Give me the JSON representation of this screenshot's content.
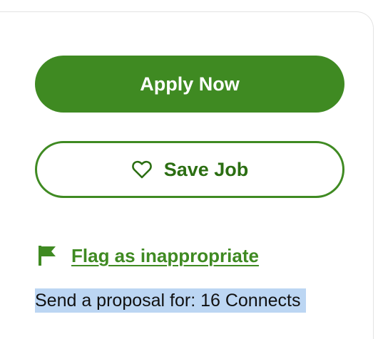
{
  "actions": {
    "apply_label": "Apply Now",
    "save_label": "Save Job",
    "flag_label": "Flag as inappropriate"
  },
  "proposal": {
    "text": "Send a proposal for: 16 Connects"
  },
  "icons": {
    "save": "heart-outline-icon",
    "flag": "flag-icon"
  },
  "colors": {
    "brand_green": "#3f8a22",
    "selection_highlight": "#bcd6f3"
  }
}
